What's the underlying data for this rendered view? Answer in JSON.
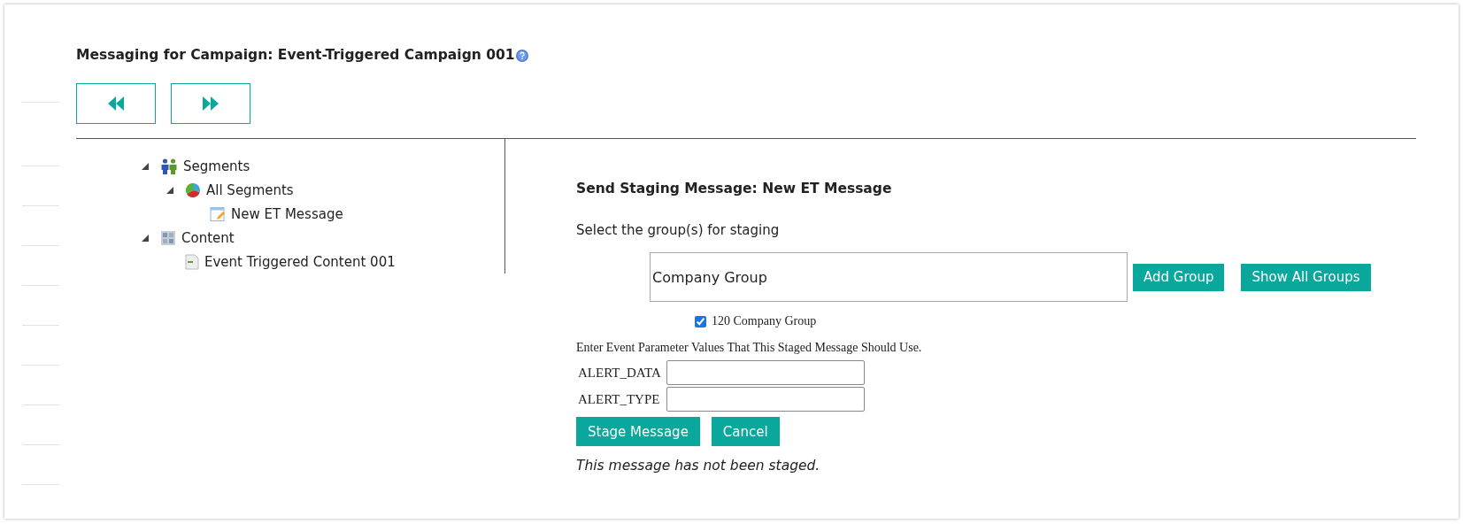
{
  "title": "Messaging for Campaign: Event-Triggered Campaign 001",
  "nav_buttons": [
    {
      "kind": "previous"
    },
    {
      "kind": "next"
    }
  ],
  "tree": [
    {
      "label": "Segments",
      "kind": "people",
      "expanded": true,
      "children": [
        {
          "label": "All Segments",
          "kind": "pie",
          "expanded": true,
          "children": [
            {
              "label": "New ET Message",
              "kind": "note"
            }
          ]
        }
      ]
    },
    {
      "label": "Content",
      "kind": "grid",
      "expanded": true,
      "children": [
        {
          "label": "Event Triggered Content 001",
          "kind": "doc"
        }
      ]
    }
  ],
  "panel": {
    "heading": "Send Staging Message: New ET Message",
    "group_prompt": "Select the group(s) for staging",
    "group_field": {
      "value": "Company Group"
    },
    "group_buttons": [
      "Add Group",
      "Show All Groups"
    ],
    "groups": [
      {
        "label": "120 Company Group",
        "checked": true
      }
    ],
    "param_prompt": "Enter Event Parameter Values That This Staged Message Should Use.",
    "params": [
      {
        "label": "ALERT_DATA"
      },
      {
        "label": "ALERT_TYPE"
      }
    ],
    "actions": [
      "Stage Message",
      "Cancel"
    ],
    "status": "This message has not been staged."
  }
}
